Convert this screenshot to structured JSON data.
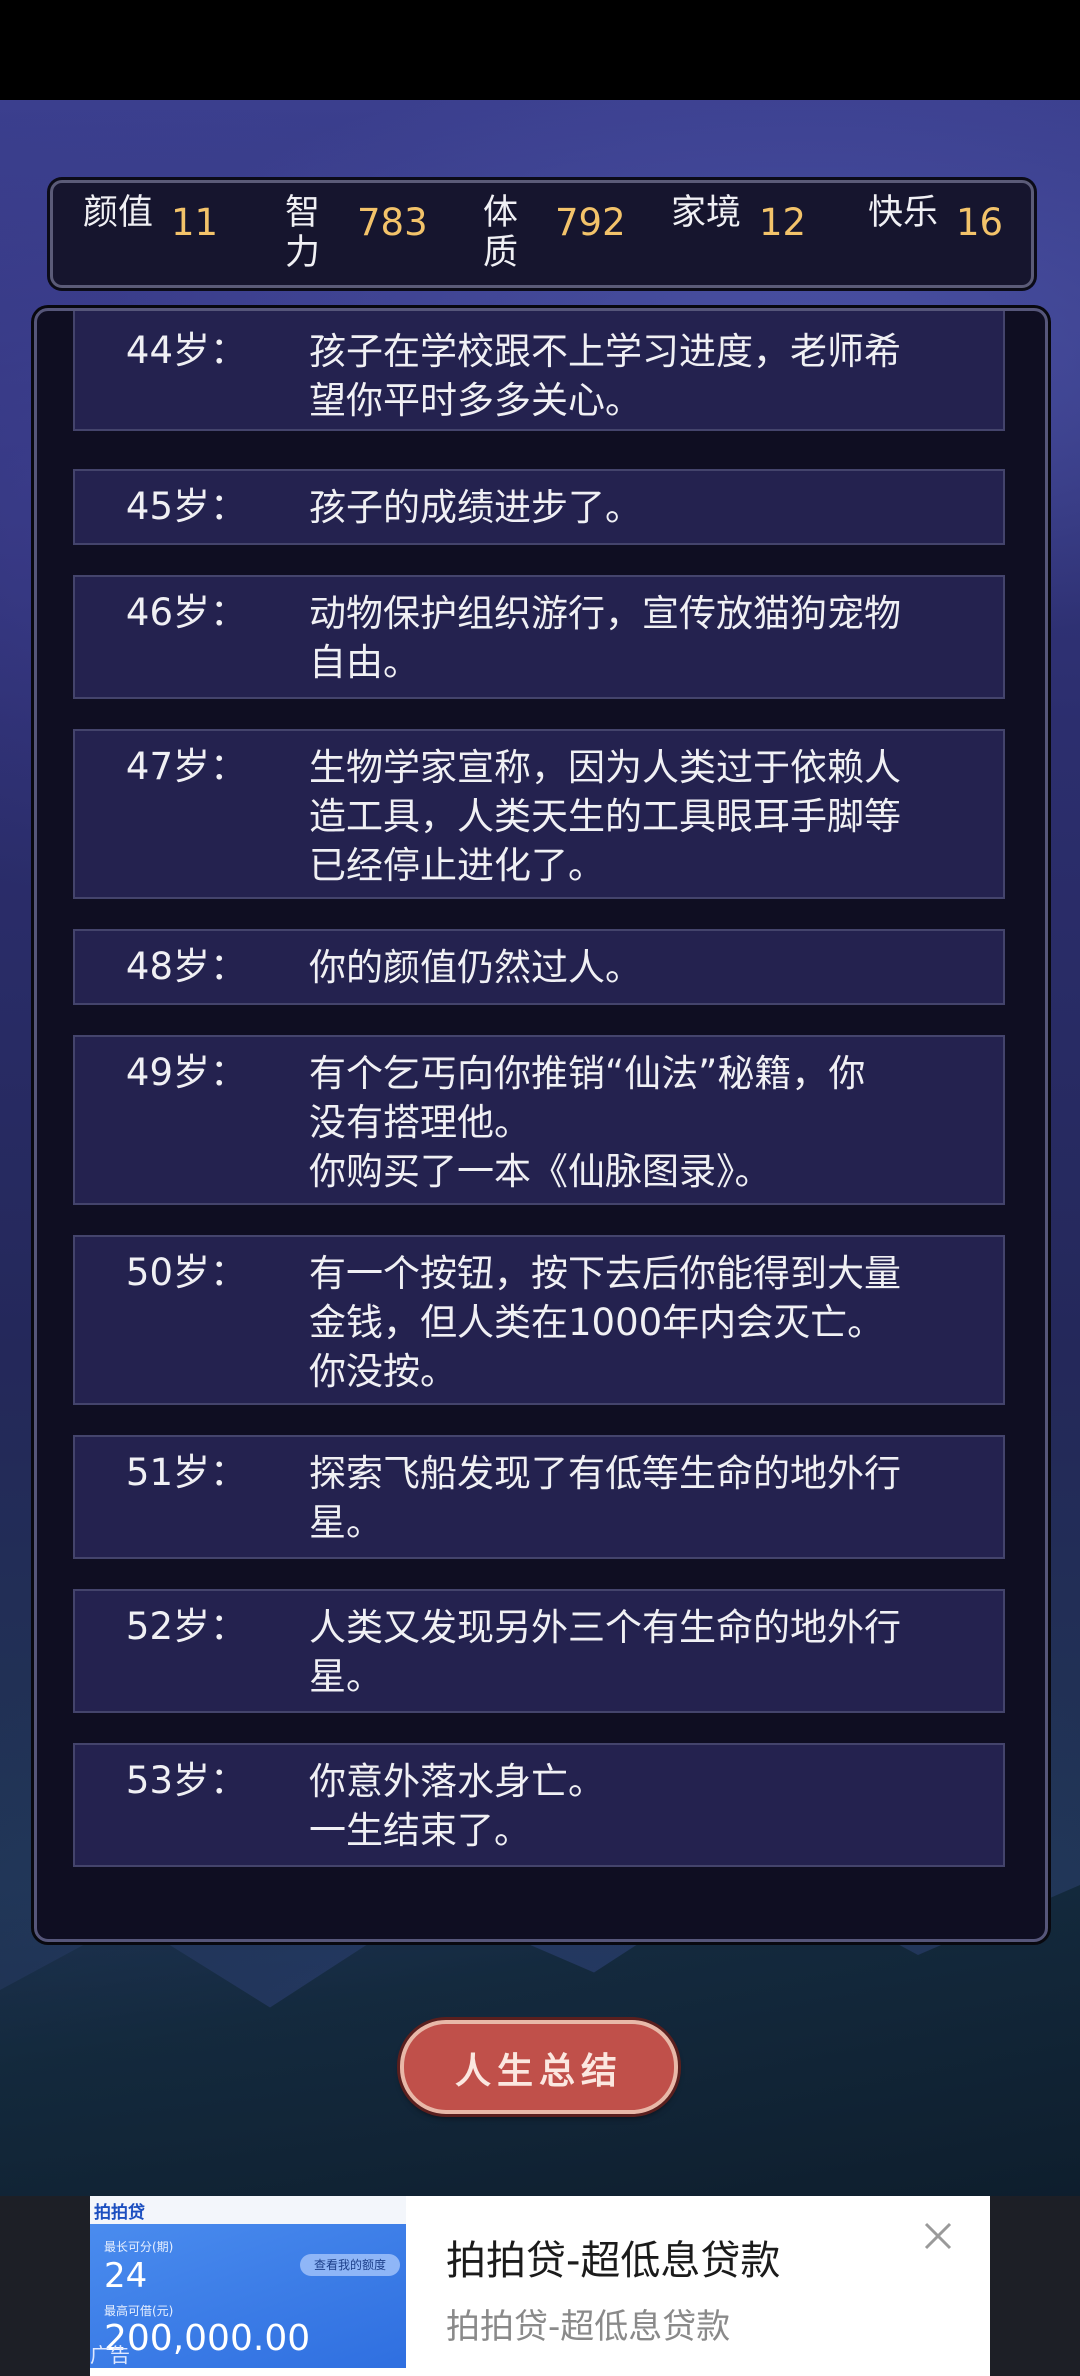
{
  "stats": [
    {
      "label": "颜值",
      "value": "11"
    },
    {
      "label": "智力",
      "value": "783"
    },
    {
      "label": "体质",
      "value": "792"
    },
    {
      "label": "家境",
      "value": "12"
    },
    {
      "label": "快乐",
      "value": "16"
    }
  ],
  "events": [
    {
      "age": "44岁：",
      "text": "孩子在学校跟不上学习进度，老师希\n望你平时多多关心。"
    },
    {
      "age": "45岁：",
      "text": "孩子的成绩进步了。"
    },
    {
      "age": "46岁：",
      "text": "动物保护组织游行，宣传放猫狗宠物\n自由。"
    },
    {
      "age": "47岁：",
      "text": "生物学家宣称，因为人类过于依赖人\n造工具，人类天生的工具眼耳手脚等\n已经停止进化了。"
    },
    {
      "age": "48岁：",
      "text": "你的颜值仍然过人。"
    },
    {
      "age": "49岁：",
      "text": "有个乞丐向你推销“仙法”秘籍，你\n没有搭理他。\n你购买了一本《仙脉图录》。"
    },
    {
      "age": "50岁：",
      "text": "有一个按钮，按下去后你能得到大量\n金钱，但人类在1000年内会灭亡。\n你没按。"
    },
    {
      "age": "51岁：",
      "text": "探索飞船发现了有低等生命的地外行\n星。"
    },
    {
      "age": "52岁：",
      "text": "人类又发现另外三个有生命的地外行\n星。"
    },
    {
      "age": "53岁：",
      "text": "你意外落水身亡。\n一生结束了。"
    }
  ],
  "summary_button": "人生总结",
  "ad": {
    "title": "拍拍贷-超低息贷款",
    "subtitle": "拍拍贷-超低息贷款",
    "logo": "拍拍贷",
    "label_period": "最长可分(期)",
    "period": "24",
    "label_amount": "最高可借(元)",
    "amount": "200,000.00",
    "pill": "查看我的额度",
    "corner": "广告"
  }
}
